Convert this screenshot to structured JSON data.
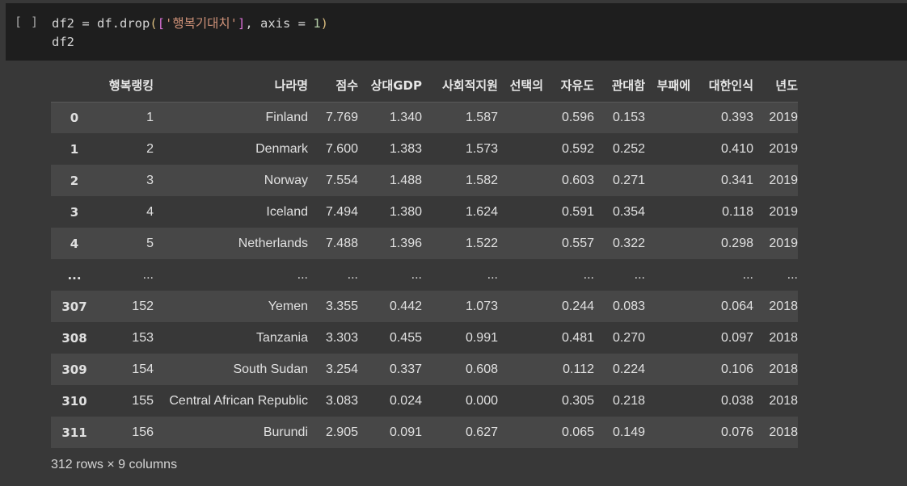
{
  "cell": {
    "run_button": "[ ]",
    "code_line1": {
      "var": "df2 = df.drop",
      "open_paren": "(",
      "open_bracket": "[",
      "string": "'행복기대치'",
      "close_bracket": "]",
      "middle": ", axis = ",
      "number": "1",
      "close_paren": ")"
    },
    "code_line2": "df2"
  },
  "table": {
    "columns": [
      "",
      "행복랭킹",
      "나라명",
      "점수",
      "상대GDP",
      "사회적지원",
      "선택의",
      "자유도",
      "관대함",
      "부패에",
      "대한인식",
      "년도"
    ],
    "rows": [
      [
        "0",
        "1",
        "Finland",
        "7.769",
        "1.340",
        "1.587",
        "",
        "0.596",
        "0.153",
        "",
        "0.393",
        "2019"
      ],
      [
        "1",
        "2",
        "Denmark",
        "7.600",
        "1.383",
        "1.573",
        "",
        "0.592",
        "0.252",
        "",
        "0.410",
        "2019"
      ],
      [
        "2",
        "3",
        "Norway",
        "7.554",
        "1.488",
        "1.582",
        "",
        "0.603",
        "0.271",
        "",
        "0.341",
        "2019"
      ],
      [
        "3",
        "4",
        "Iceland",
        "7.494",
        "1.380",
        "1.624",
        "",
        "0.591",
        "0.354",
        "",
        "0.118",
        "2019"
      ],
      [
        "4",
        "5",
        "Netherlands",
        "7.488",
        "1.396",
        "1.522",
        "",
        "0.557",
        "0.322",
        "",
        "0.298",
        "2019"
      ],
      [
        "...",
        "...",
        "...",
        "...",
        "...",
        "...",
        "",
        "...",
        "...",
        "",
        "...",
        "..."
      ],
      [
        "307",
        "152",
        "Yemen",
        "3.355",
        "0.442",
        "1.073",
        "",
        "0.244",
        "0.083",
        "",
        "0.064",
        "2018"
      ],
      [
        "308",
        "153",
        "Tanzania",
        "3.303",
        "0.455",
        "0.991",
        "",
        "0.481",
        "0.270",
        "",
        "0.097",
        "2018"
      ],
      [
        "309",
        "154",
        "South Sudan",
        "3.254",
        "0.337",
        "0.608",
        "",
        "0.112",
        "0.224",
        "",
        "0.106",
        "2018"
      ],
      [
        "310",
        "155",
        "Central African Republic",
        "3.083",
        "0.024",
        "0.000",
        "",
        "0.305",
        "0.218",
        "",
        "0.038",
        "2018"
      ],
      [
        "311",
        "156",
        "Burundi",
        "2.905",
        "0.091",
        "0.627",
        "",
        "0.065",
        "0.149",
        "",
        "0.076",
        "2018"
      ]
    ],
    "summary": "312 rows × 9 columns"
  }
}
